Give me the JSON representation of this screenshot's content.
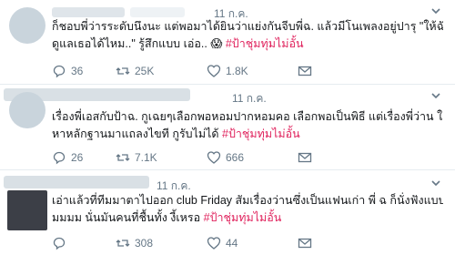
{
  "tweets": [
    {
      "date": "11 ก.ค.",
      "text_lines": [
        [
          "ก็ชอบพี่ว่ารระดับนึงนะ แต่พอมาได้ยินว่าแย่งกันจีบพี่ฉ. แล้วมีโนเพลงอยู่ปารุ \"ให้ฉันได้",
          null
        ],
        [
          "ดูแลเธอได้ไหม..\" รู้สึกแบบ เอ่อ..",
          "😱"
        ],
        [
          "#ป้าชุ่มทุ่มไม่อั้น",
          null
        ]
      ],
      "hashtag": "#ป้าชุ่มทุ่มไม่อั้น",
      "replies": "36",
      "retweets": "25K",
      "likes": "1.8K"
    },
    {
      "date": "11 ก.ค.",
      "text_lines": [
        "เรื่องพี่เอสกับป้าฉ. กูเฉยๆเลือกพอหอมปากหอมคอ เลือกพอเป็นพิธี แต่เรื่องพี่ว่าน ใครก็",
        "หาหลักฐานมาแถลงไขที กูรับไม่ได้"
      ],
      "hashtag": "#ป้าชุ่มทุ่มไม่อั้น",
      "replies": "26",
      "retweets": "7.1K",
      "likes": "666"
    },
    {
      "date": "11 ก.ค.",
      "text_lines": [
        "เอ่าแล้วที่ทีมมาตาไปออก club Friday สัมเรื่องว่านซึ่งเป็นแฟนเก่า พี่ ฉ ก็นั่งฟังแบบ หึม",
        "มมมม นั่นมันคนที่ชื้นทั้ง งี้เหรอ"
      ],
      "hashtag": "#ป้าชุ่มทุ่มไม่อั้น",
      "replies": "",
      "retweets": "308",
      "likes": "44"
    }
  ],
  "icons": {
    "reply": "reply-icon",
    "retweet": "retweet-icon",
    "like": "heart-icon",
    "message": "envelope-icon",
    "menu": "chevron-down-icon"
  },
  "colors": {
    "hashtag": "#e0245e",
    "action": "#657786",
    "divider": "#e6ecf0"
  }
}
